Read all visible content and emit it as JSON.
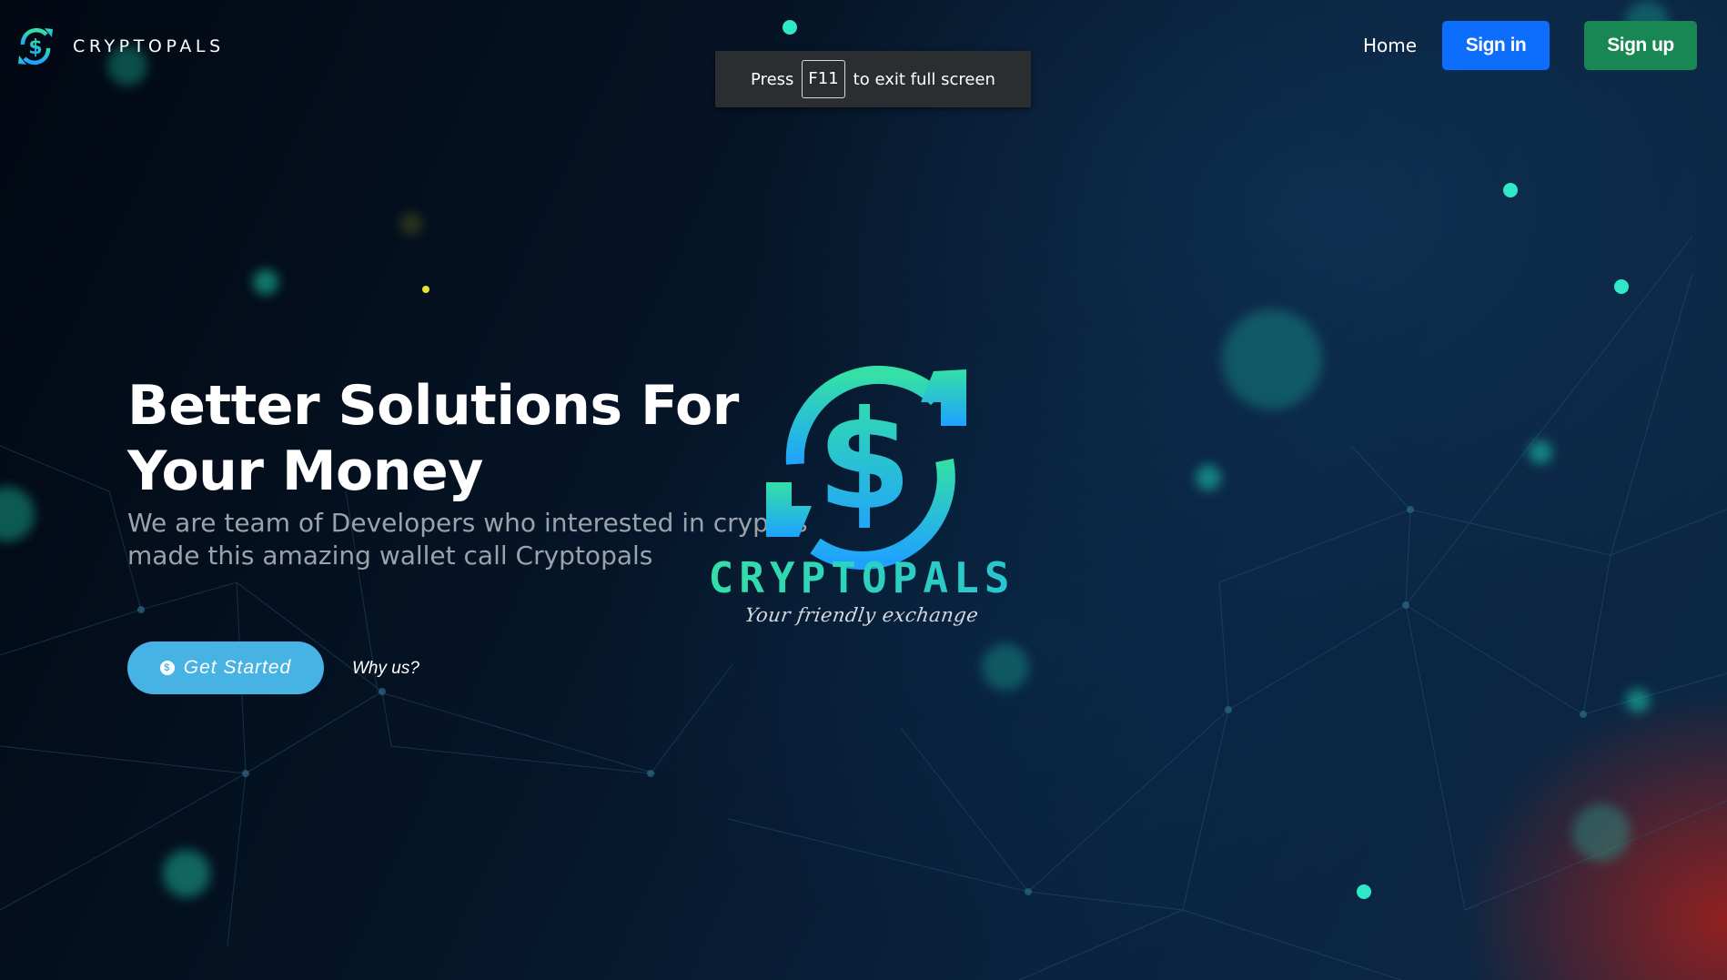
{
  "brand": {
    "name": "CRYPTOPALS"
  },
  "nav": {
    "home": "Home",
    "sign_in": "Sign in",
    "sign_up": "Sign up"
  },
  "toast": {
    "press": "Press",
    "key": "F11",
    "suffix": "to exit full screen"
  },
  "hero": {
    "title": "Better Solutions For Your Money",
    "subtitle": "We are team of Developers who interested in cryptos made this amazing wallet call Cryptopals",
    "cta": "Get Started",
    "secondary": "Why us?"
  },
  "logo": {
    "word": "CRYPTOPALS",
    "tagline": "Your friendly exchange"
  },
  "colors": {
    "sign_in_bg": "#0d6efd",
    "sign_up_bg": "#198754",
    "cta_bg": "#47b2e4",
    "logo_gradient": [
      "#34e0a6",
      "#1fa2ff"
    ]
  },
  "icons": {
    "brand": "dollar-exchange-icon",
    "cta": "coin-icon"
  }
}
